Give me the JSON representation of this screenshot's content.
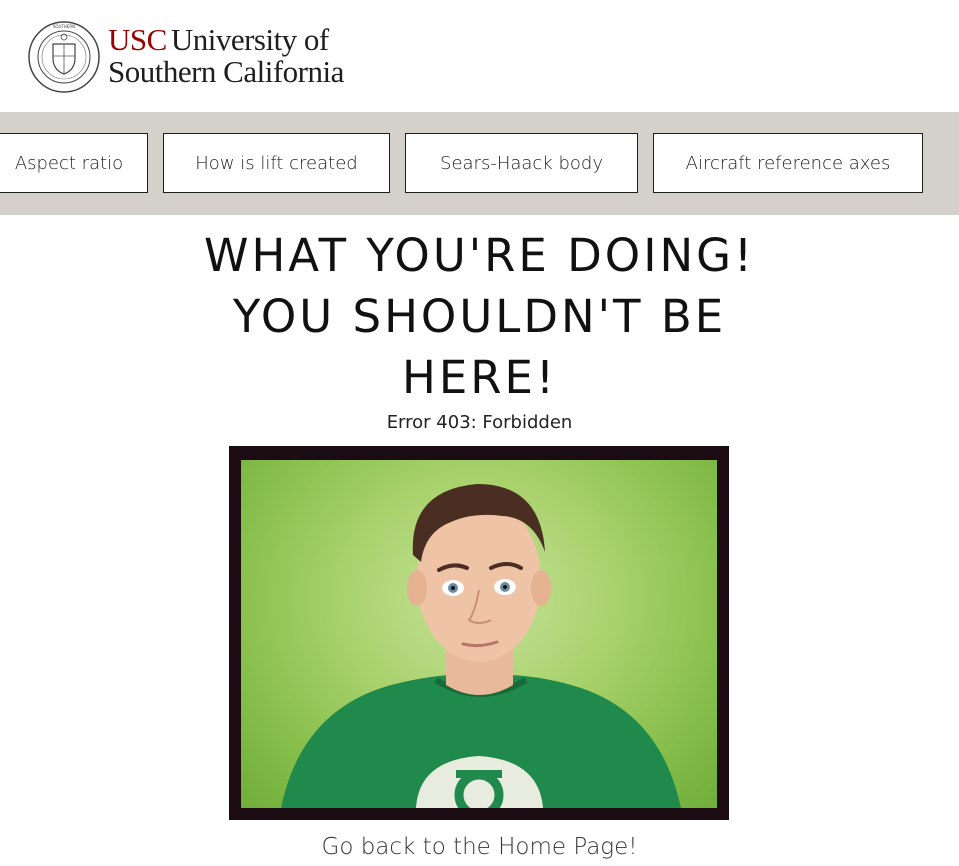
{
  "header": {
    "logo_abbr": "USC",
    "logo_line1_rest": "University of",
    "logo_line2": "Southern California",
    "seal_text": "UNIVERSITY OF SOUTHERN CALIFORNIA 1880"
  },
  "nav": {
    "items": [
      {
        "label": "Aspect ratio"
      },
      {
        "label": "How is lift created"
      },
      {
        "label": "Sears-Haack body"
      },
      {
        "label": "Aircraft reference axes"
      }
    ]
  },
  "main": {
    "headline_lines": [
      "WHAT YOU'RE DOING!",
      "YOU SHOULDN'T BE",
      "HERE!"
    ],
    "error_text": "Error 403: Forbidden",
    "photo_icon": "person-photo",
    "home_link": "Go back to the Home Page!"
  },
  "colors": {
    "brand_red": "#990000",
    "nav_background": "#d4d1cb",
    "photo_background": "#a9d26d",
    "shirt_green": "#1f8a4c"
  }
}
